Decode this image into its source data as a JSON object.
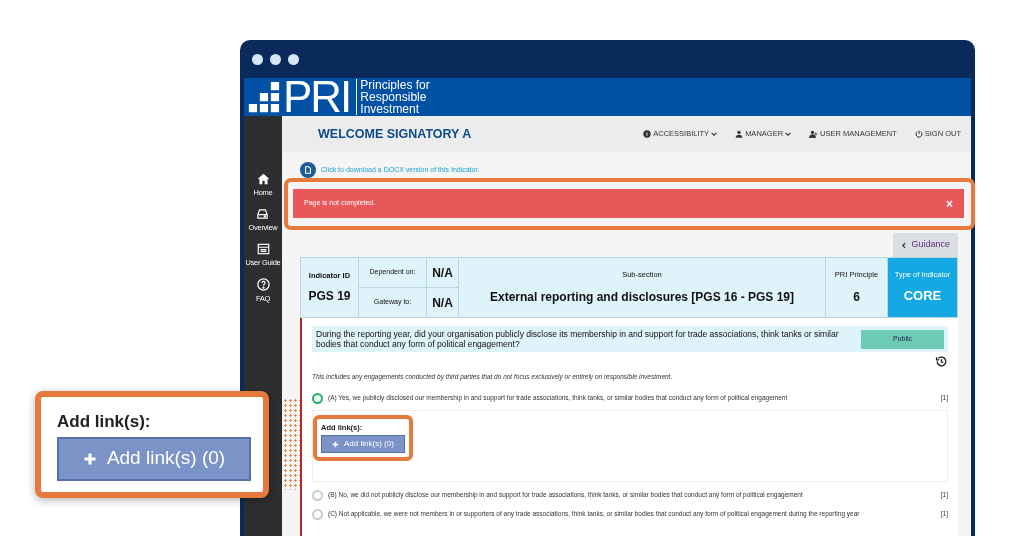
{
  "header": {
    "logo": "PRI",
    "tagline": [
      "Principles for",
      "Responsible",
      "Investment"
    ]
  },
  "topbar": {
    "title": "WELCOME SIGNATORY A",
    "nav": [
      {
        "label": "ACCESSIBILITY",
        "kind": "info",
        "dropdown": true
      },
      {
        "label": "MANAGER",
        "kind": "user",
        "dropdown": true
      },
      {
        "label": "USER MANAGEMENT",
        "kind": "users",
        "dropdown": false
      },
      {
        "label": "SIGN OUT",
        "kind": "power",
        "dropdown": false
      }
    ]
  },
  "sidebar": {
    "items": [
      {
        "label": "Home",
        "kind": "home"
      },
      {
        "label": "Overview",
        "kind": "drive"
      },
      {
        "label": "User Guide",
        "kind": "guide"
      },
      {
        "label": "FAQ",
        "kind": "help"
      }
    ]
  },
  "download_link": "Click to download a DOCX version of this Indicator.",
  "alert": {
    "message": "Page is not completed.",
    "close": "×"
  },
  "guidance_button": "Guidance",
  "indicator": {
    "id_label": "Indicator ID",
    "id": "PGS 19",
    "dependent_label": "Dependent on:",
    "dependent": "N/A",
    "gateway_label": "Gateway to:",
    "gateway": "N/A",
    "subsection_label": "Sub-section",
    "subsection": "External reporting and disclosures [PGS 16 - PGS 19]",
    "principle_label": "PRI Principle",
    "principle": "6",
    "type_label": "Type of Indicator",
    "type": "CORE"
  },
  "question": {
    "text": "During the reporting year, did your organisation publicly disclose its membership in and support for trade associations, think tanks or similar bodies that conduct any form of political engagement?",
    "visibility": "Public",
    "note": "This includes any engagements conducted by third parties that do not focus exclusively or entirely on responsible investment.",
    "options": [
      {
        "label": "(A) Yes, we publicly disclosed our membership in and support for trade associations, think tanks, or similar bodies that conduct any form of political engagement",
        "reference": "[1]",
        "selected": true,
        "links_label": "Add link(s):",
        "links_button": "Add link(s) (0)"
      },
      {
        "label": "(B) No, we did not publicly disclose our membership in and support for trade associations, think tanks, or similar bodies that conduct any form of political engagement",
        "reference": "[1]",
        "selected": false
      },
      {
        "label": "(C) Not applicable, we were not members in or supporters of any trade associations, think tanks, or similar bodies that conduct any form of political engagement during the reporting year",
        "reference": "[1]",
        "selected": false
      }
    ]
  },
  "callout": {
    "label": "Add link(s):",
    "button": "Add link(s) (0)"
  }
}
